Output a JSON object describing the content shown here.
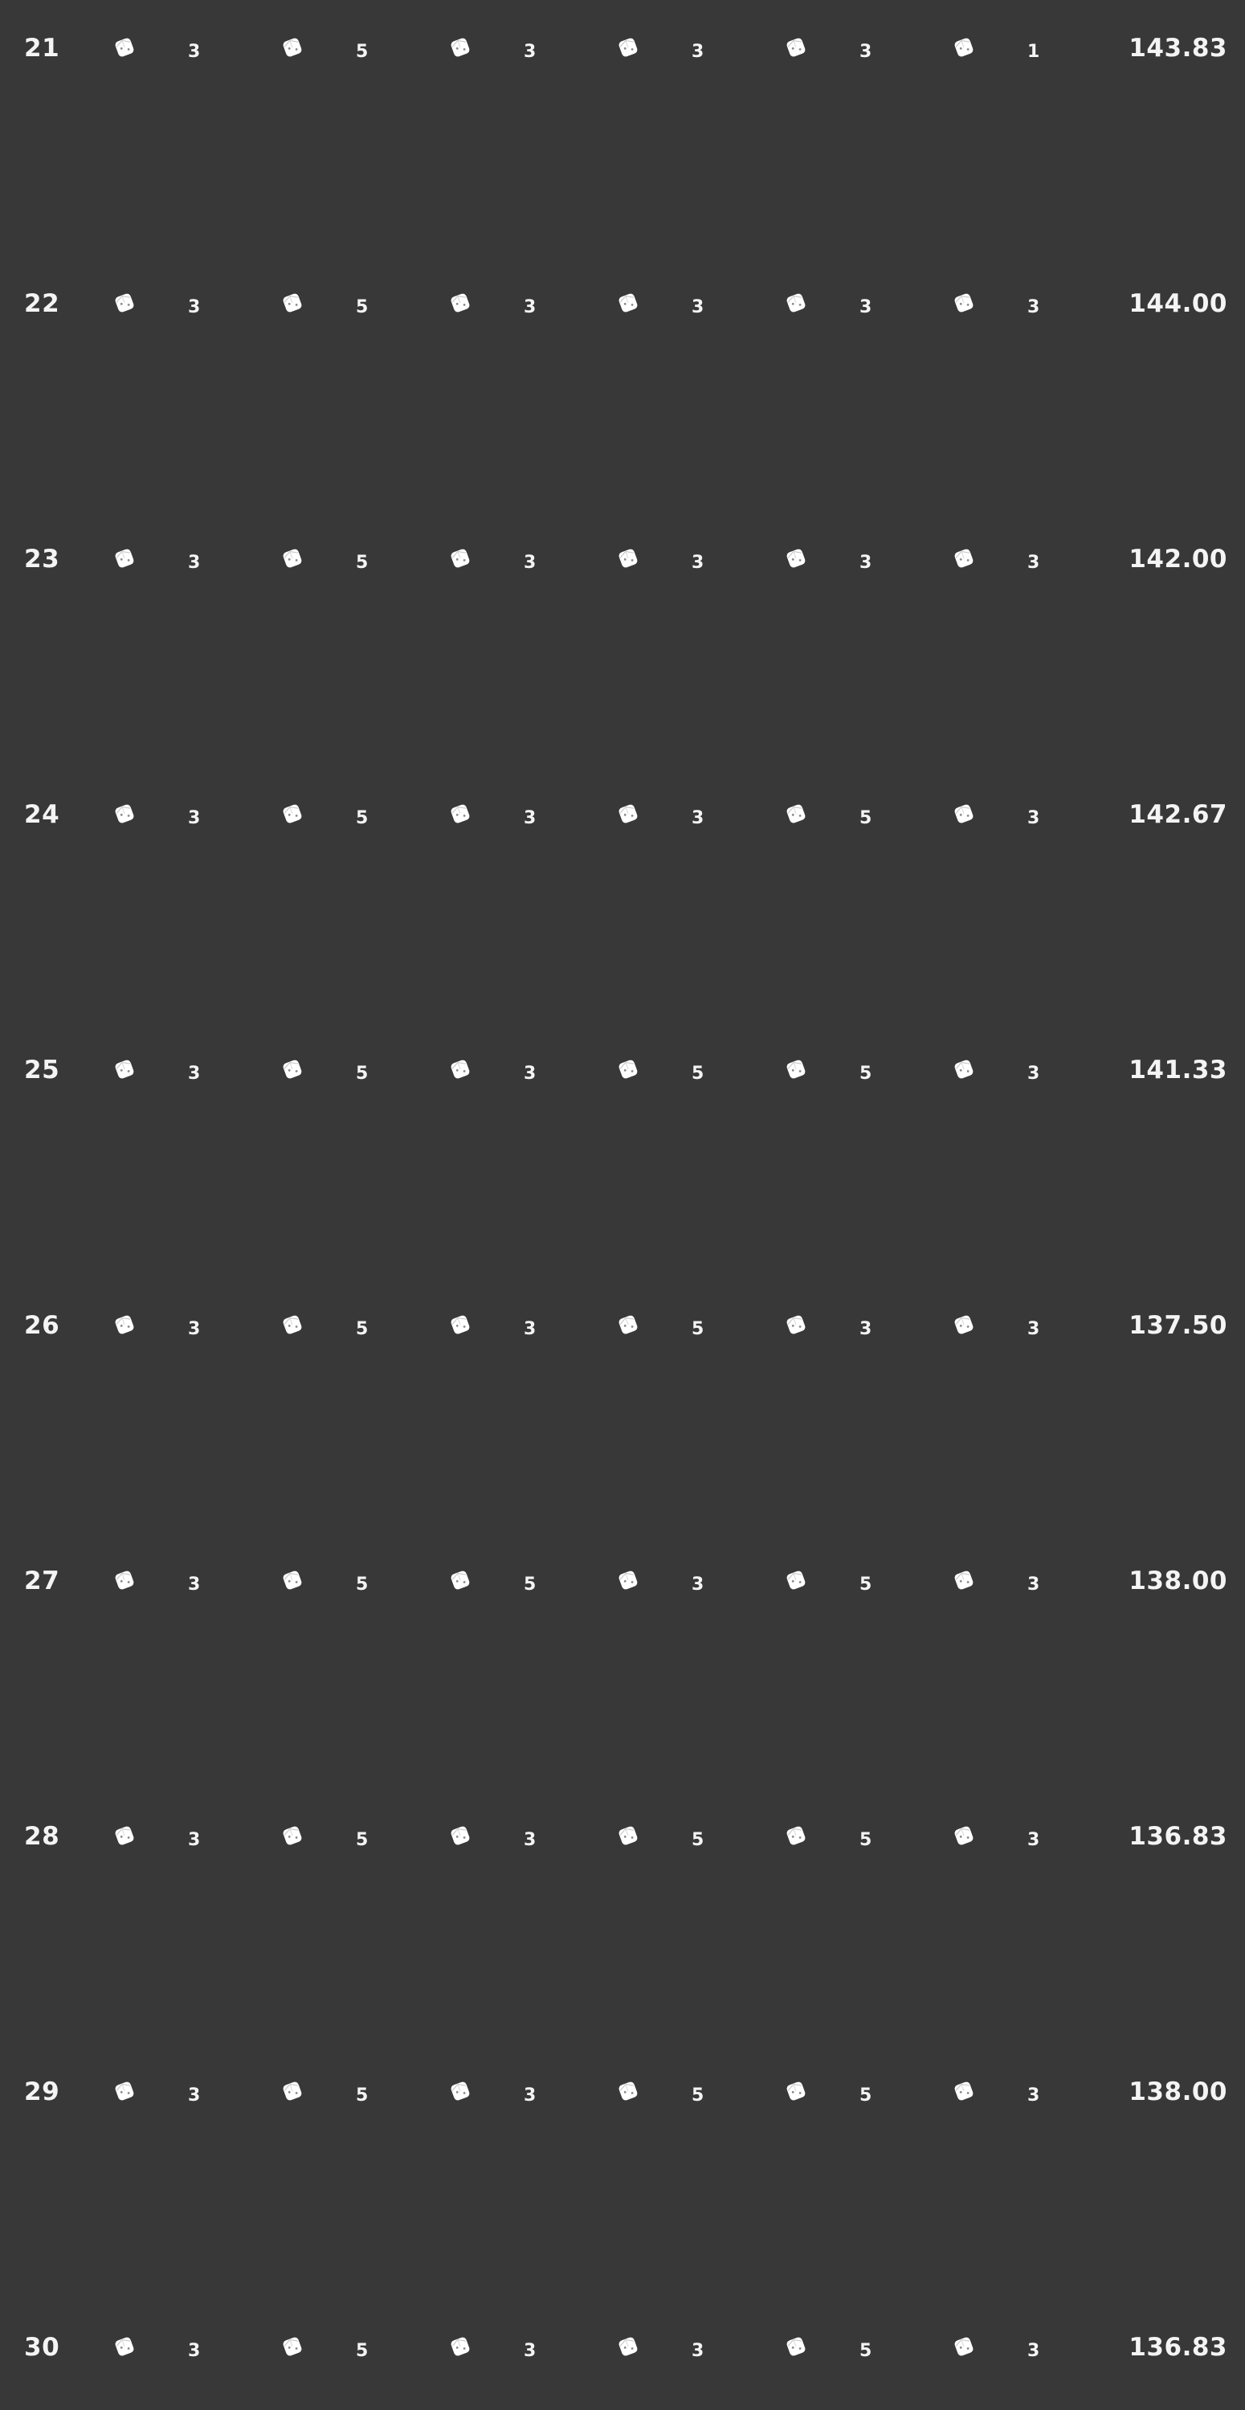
{
  "theme": {
    "background": "#373837",
    "text": "#f4f4f4",
    "die_fill": "#ffffff"
  },
  "die_icon": "die-icon",
  "rows": [
    {
      "number": "21",
      "dice": [
        "3",
        "5",
        "3",
        "3",
        "3",
        "1"
      ],
      "score": "143.83"
    },
    {
      "number": "22",
      "dice": [
        "3",
        "5",
        "3",
        "3",
        "3",
        "3"
      ],
      "score": "144.00"
    },
    {
      "number": "23",
      "dice": [
        "3",
        "5",
        "3",
        "3",
        "3",
        "3"
      ],
      "score": "142.00"
    },
    {
      "number": "24",
      "dice": [
        "3",
        "5",
        "3",
        "3",
        "5",
        "3"
      ],
      "score": "142.67"
    },
    {
      "number": "25",
      "dice": [
        "3",
        "5",
        "3",
        "5",
        "5",
        "3"
      ],
      "score": "141.33"
    },
    {
      "number": "26",
      "dice": [
        "3",
        "5",
        "3",
        "5",
        "3",
        "3"
      ],
      "score": "137.50"
    },
    {
      "number": "27",
      "dice": [
        "3",
        "5",
        "5",
        "3",
        "5",
        "3"
      ],
      "score": "138.00"
    },
    {
      "number": "28",
      "dice": [
        "3",
        "5",
        "3",
        "5",
        "5",
        "3"
      ],
      "score": "136.83"
    },
    {
      "number": "29",
      "dice": [
        "3",
        "5",
        "3",
        "5",
        "5",
        "3"
      ],
      "score": "138.00"
    },
    {
      "number": "30",
      "dice": [
        "3",
        "5",
        "3",
        "3",
        "5",
        "3"
      ],
      "score": "136.83"
    }
  ]
}
